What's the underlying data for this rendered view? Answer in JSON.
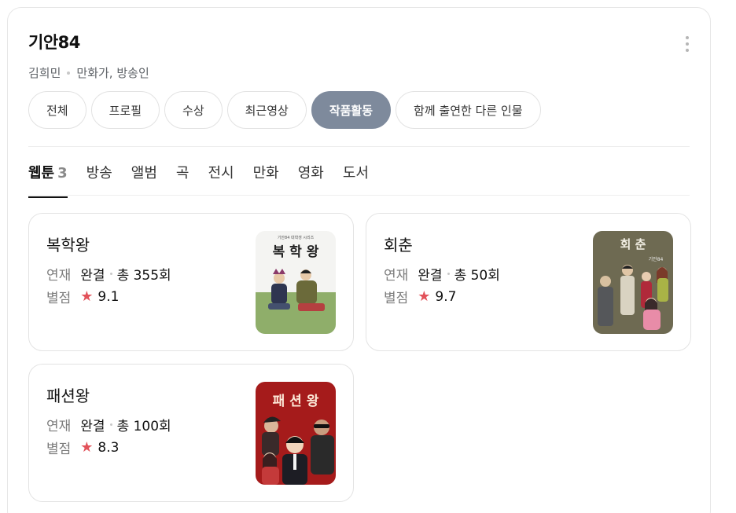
{
  "profile": {
    "name": "기안84",
    "real_name": "김희민",
    "roles": "만화가, 방송인"
  },
  "chips": [
    {
      "label": "전체",
      "active": false
    },
    {
      "label": "프로필",
      "active": false
    },
    {
      "label": "수상",
      "active": false
    },
    {
      "label": "최근영상",
      "active": false
    },
    {
      "label": "작품활동",
      "active": true
    },
    {
      "label": "함께 출연한 다른 인물",
      "active": false
    }
  ],
  "tabs": [
    {
      "label": "웹툰",
      "count": "3",
      "active": true
    },
    {
      "label": "방송"
    },
    {
      "label": "앨범"
    },
    {
      "label": "곡"
    },
    {
      "label": "전시"
    },
    {
      "label": "만화"
    },
    {
      "label": "영화"
    },
    {
      "label": "도서"
    }
  ],
  "works": [
    {
      "title": "복학왕",
      "serial_label": "연재",
      "status": "완결",
      "episodes": "총 355회",
      "rating_label": "별점",
      "rating": "9.1",
      "cover_title": "복 학 왕",
      "cover_sub": "기안84 대학생 시리즈"
    },
    {
      "title": "회춘",
      "serial_label": "연재",
      "status": "완결",
      "episodes": "총 50회",
      "rating_label": "별점",
      "rating": "9.7",
      "cover_title": "회 춘",
      "cover_sub": "기안84"
    },
    {
      "title": "패션왕",
      "serial_label": "연재",
      "status": "완결",
      "episodes": "총 100회",
      "rating_label": "별점",
      "rating": "8.3",
      "cover_title": "패 션 왕",
      "cover_sub": ""
    }
  ],
  "colors": {
    "active_chip": "#7e8a9c",
    "star": "#e2525a",
    "muted": "#7c7c7c"
  }
}
